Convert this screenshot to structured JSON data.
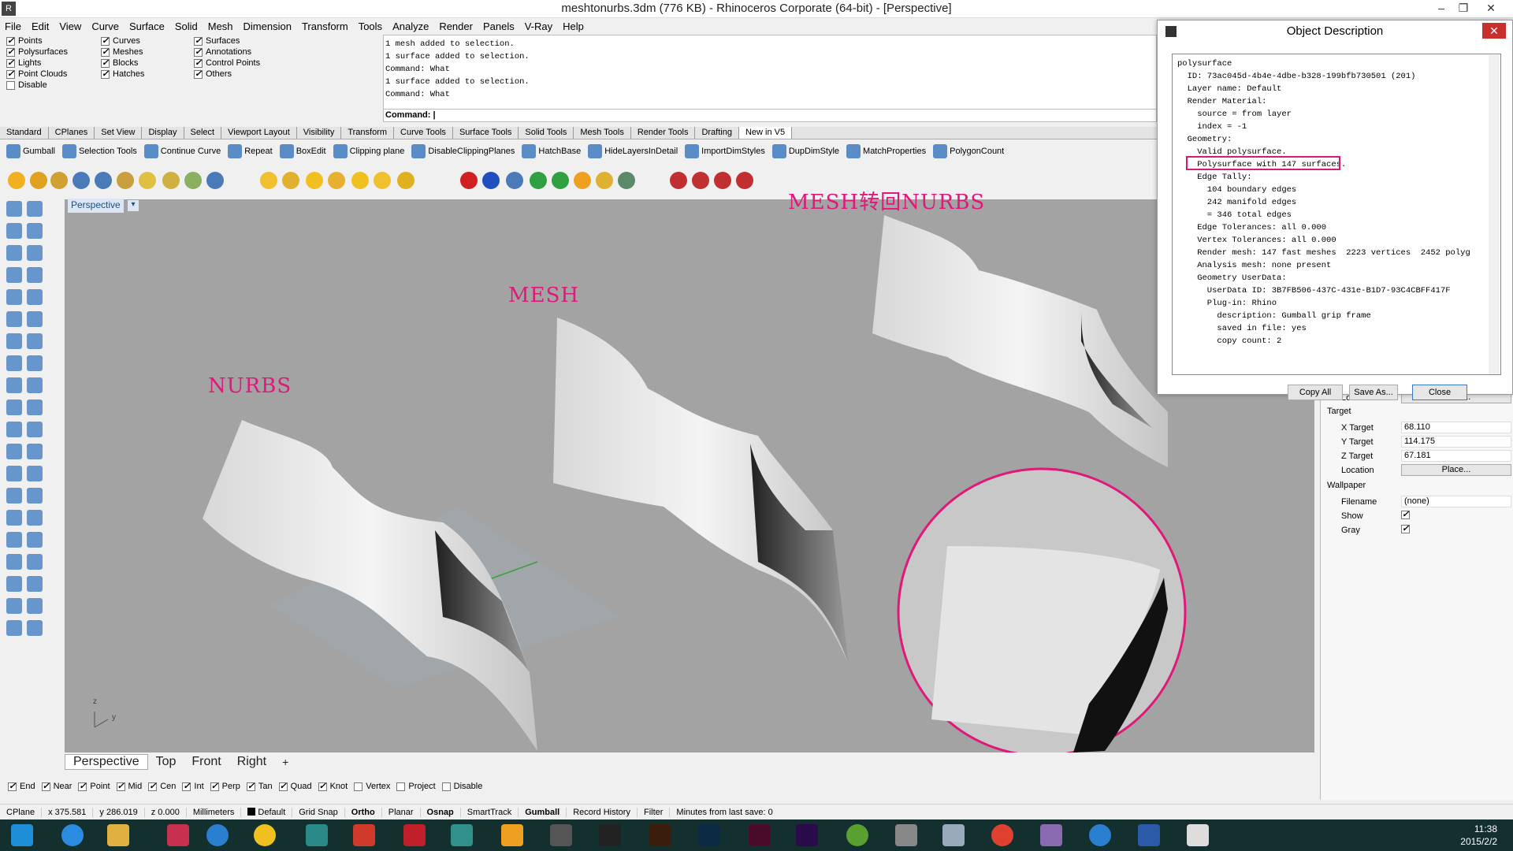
{
  "window": {
    "title": "meshtonurbs.3dm (776 KB) - Rhinoceros Corporate (64-bit) - [Perspective]"
  },
  "menu": [
    "File",
    "Edit",
    "View",
    "Curve",
    "Surface",
    "Solid",
    "Mesh",
    "Dimension",
    "Transform",
    "Tools",
    "Analyze",
    "Render",
    "Panels",
    "V-Ray",
    "Help"
  ],
  "filters": [
    {
      "label": "Points",
      "checked": true
    },
    {
      "label": "Polysurfaces",
      "checked": true
    },
    {
      "label": "Lights",
      "checked": true
    },
    {
      "label": "Point Clouds",
      "checked": true
    },
    {
      "label": "Disable",
      "checked": false
    },
    {
      "label": "Curves",
      "checked": true
    },
    {
      "label": "Meshes",
      "checked": true
    },
    {
      "label": "Blocks",
      "checked": true
    },
    {
      "label": "Hatches",
      "checked": true
    },
    {
      "label": "Surfaces",
      "checked": true
    },
    {
      "label": "Annotations",
      "checked": true
    },
    {
      "label": "Control Points",
      "checked": true
    },
    {
      "label": "Others",
      "checked": true
    }
  ],
  "history": [
    "1 mesh added to selection.",
    "1 surface added to selection.",
    "Command: What",
    "1 surface added to selection.",
    "Command: What"
  ],
  "command": {
    "prompt": "Command:",
    "value": ""
  },
  "tabs": [
    "Standard",
    "CPlanes",
    "Set View",
    "Display",
    "Select",
    "Viewport Layout",
    "Visibility",
    "Transform",
    "Curve Tools",
    "Surface Tools",
    "Solid Tools",
    "Mesh Tools",
    "Render Tools",
    "Drafting",
    "New in V5"
  ],
  "active_tab": "New in V5",
  "cmd_toolbar": [
    "Gumball",
    "Selection Tools",
    "Continue Curve",
    "Repeat",
    "BoxEdit",
    "Clipping plane",
    "DisableClippingPlanes",
    "HatchBase",
    "HideLayersInDetail",
    "ImportDimStyles",
    "DupDimStyle",
    "MatchProperties",
    "PolygonCount"
  ],
  "viewport": {
    "label": "Perspective",
    "axis_z": "z",
    "axis_y": "y"
  },
  "annotations": {
    "nurbs": "NURBS",
    "mesh": "MESH",
    "mesh_to_nurbs": "MESH转回NURBS"
  },
  "viewport_tabs": [
    "Perspective",
    "Top",
    "Front",
    "Right"
  ],
  "osnaps": [
    {
      "label": "End",
      "checked": true
    },
    {
      "label": "Near",
      "checked": true
    },
    {
      "label": "Point",
      "checked": true
    },
    {
      "label": "Mid",
      "checked": true
    },
    {
      "label": "Cen",
      "checked": true
    },
    {
      "label": "Int",
      "checked": true
    },
    {
      "label": "Perp",
      "checked": true
    },
    {
      "label": "Tan",
      "checked": true
    },
    {
      "label": "Quad",
      "checked": true
    },
    {
      "label": "Knot",
      "checked": true
    },
    {
      "label": "Vertex",
      "checked": false
    },
    {
      "label": "Project",
      "checked": false
    },
    {
      "label": "Disable",
      "checked": false
    }
  ],
  "status": {
    "cplane": "CPlane",
    "x": "x 375.581",
    "y": "y 286.019",
    "z": "z 0.000",
    "units": "Millimeters",
    "layer": "Default",
    "toggles": [
      "Grid Snap",
      "Ortho",
      "Planar",
      "Osnap",
      "SmartTrack",
      "Gumball",
      "Record History",
      "Filter"
    ],
    "bold_toggles": [
      "Ortho",
      "Osnap",
      "Gumball"
    ],
    "save": "Minutes from last save: 0"
  },
  "dialog": {
    "title": "Object Description",
    "lines": [
      "polysurface",
      "  ID: 73ac045d-4b4e-4dbe-b328-199bfb730501 (201)",
      "  Layer name: Default",
      "  Render Material:",
      "    source = from layer",
      "    index = -1",
      "  Geometry:",
      "    Valid polysurface.",
      "    Polysurface with 147 surfaces.",
      "    Edge Tally:",
      "      104 boundary edges",
      "      242 manifold edges",
      "      = 346 total edges",
      "    Edge Tolerances: all 0.000",
      "    Vertex Tolerances: all 0.000",
      "    Render mesh: 147 fast meshes  2223 vertices  2452 polyg",
      "    Analysis mesh: none present",
      "    Geometry UserData:",
      "      UserData ID: 3B7FB506-437C-431e-B1D7-93C4CBFF417F",
      "      Plug-in: Rhino",
      "        description: Gumball grip frame",
      "        saved in file: yes",
      "        copy count: 2"
    ],
    "buttons": {
      "copy_all": "Copy All",
      "save_as": "Save As...",
      "close": "Close"
    }
  },
  "properties": {
    "location1_label": "Location",
    "location1_btn": "Place...",
    "target_header": "Target",
    "x_target_label": "X Target",
    "x_target": "68.110",
    "y_target_label": "Y Target",
    "y_target": "114.175",
    "z_target_label": "Z Target",
    "z_target": "67.181",
    "location2_label": "Location",
    "location2_btn": "Place...",
    "wallpaper_header": "Wallpaper",
    "filename_label": "Filename",
    "filename": "(none)",
    "show_label": "Show",
    "gray_label": "Gray"
  },
  "taskbar": {
    "time": "11:38",
    "date": "2015/2/2"
  },
  "colors": {
    "accent": "#e0187a",
    "viewport": "#a3a3a3",
    "taskbar": "#14302e"
  }
}
